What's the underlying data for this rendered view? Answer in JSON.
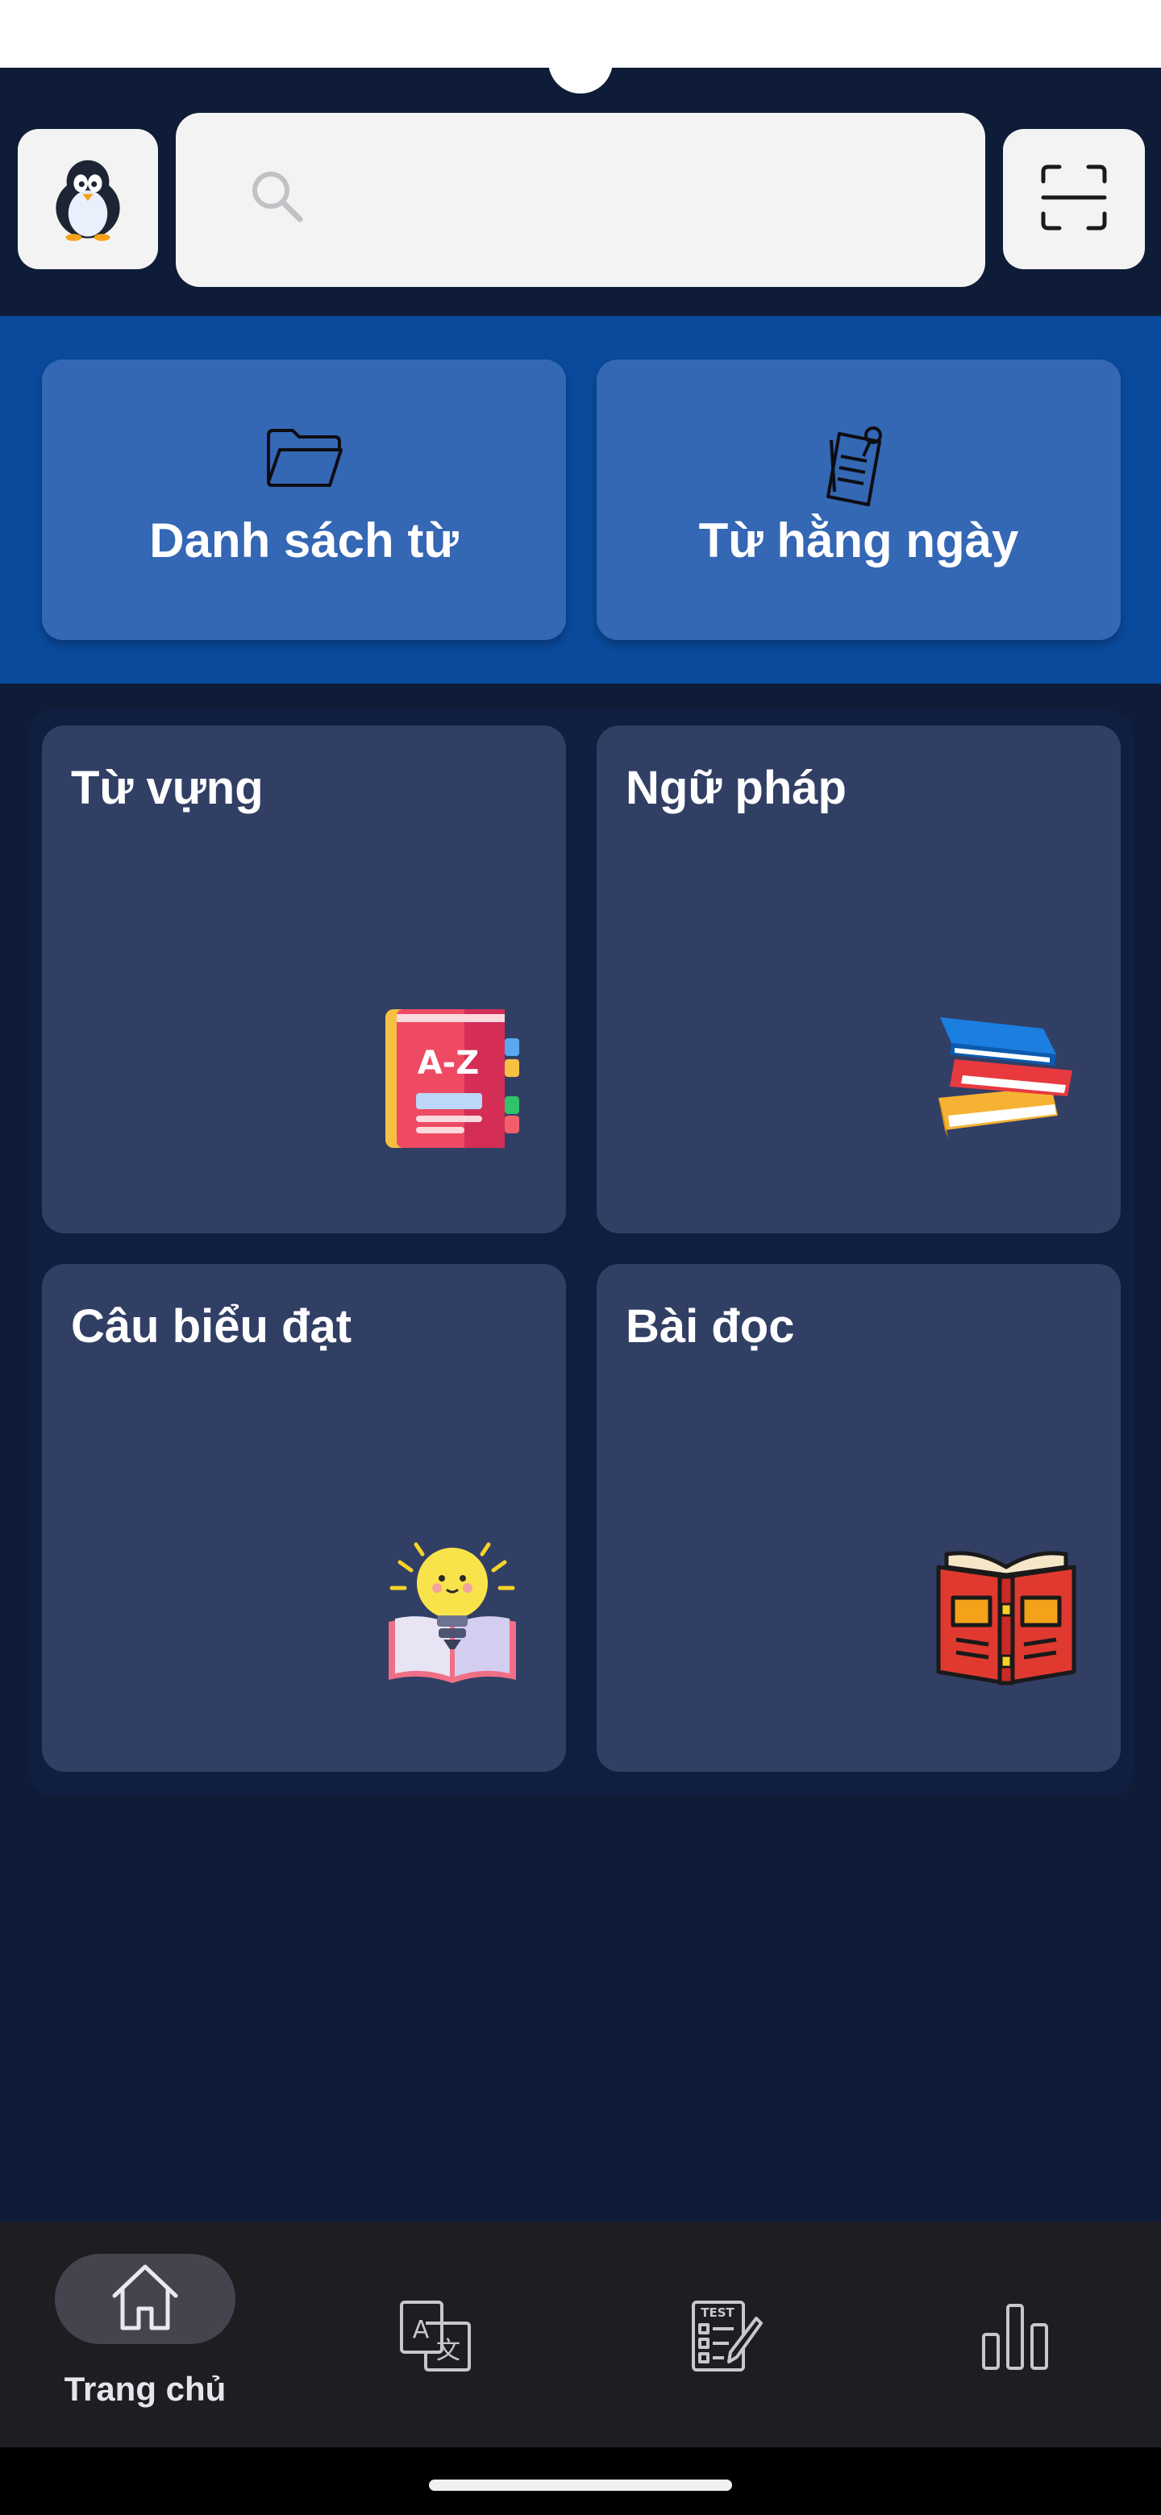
{
  "header": {
    "avatar_icon": "penguin-icon",
    "search": {
      "placeholder": "",
      "value": "",
      "icon": "search-icon"
    },
    "scan_icon": "scan-frame-icon"
  },
  "quick_actions": [
    {
      "label": "Danh sách từ",
      "icon": "folder-icon"
    },
    {
      "label": "Từ hằng ngày",
      "icon": "pinned-note-icon"
    }
  ],
  "categories": [
    {
      "label": "Từ vựng",
      "icon": "az-dictionary-book-icon"
    },
    {
      "label": "Ngữ pháp",
      "icon": "stacked-books-icon"
    },
    {
      "label": "Câu biểu đạt",
      "icon": "lightbulb-book-icon"
    },
    {
      "label": "Bài đọc",
      "icon": "open-book-reading-icon"
    }
  ],
  "bottom_nav": {
    "active_index": 0,
    "items": [
      {
        "label": "Trang chủ",
        "icon": "home-icon"
      },
      {
        "label": "",
        "icon": "translate-icon"
      },
      {
        "label": "",
        "icon": "test-checklist-icon"
      },
      {
        "label": "",
        "icon": "bar-chart-icon"
      }
    ]
  },
  "colors": {
    "background": "#0e1c38",
    "quick_band": "#0a4a9c",
    "quick_card": "#3467b4",
    "category_card": "#313f65",
    "bottom_nav": "#1e1e22",
    "nav_active_pill": "#46434e"
  }
}
